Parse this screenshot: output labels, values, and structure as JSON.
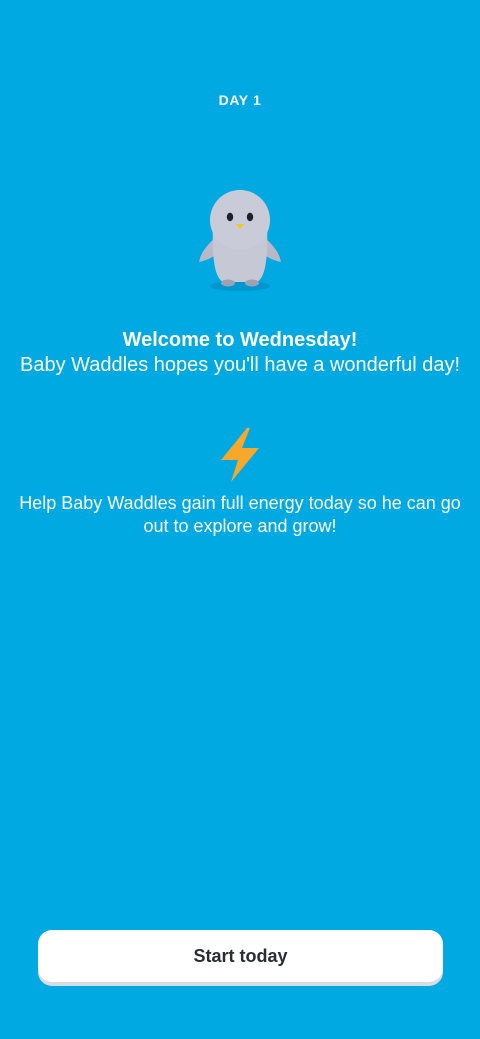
{
  "header": {
    "day_label": "DAY 1"
  },
  "mascot": {
    "icon": "penguin-icon",
    "name": "Baby Waddles"
  },
  "welcome": {
    "title": "Welcome to Wednesday!",
    "subtitle": "Baby Waddles hopes you'll have a wonderful day!"
  },
  "energy": {
    "icon": "lightning-bolt-icon",
    "message": "Help Baby Waddles gain full energy today so he can go out to explore and grow!"
  },
  "cta": {
    "label": "Start today"
  },
  "colors": {
    "background": "#00A9E2",
    "button_bg": "#FFFFFF",
    "button_text": "#2A2D34",
    "bolt": "#F7A82B",
    "penguin": "#C8CAD8"
  }
}
